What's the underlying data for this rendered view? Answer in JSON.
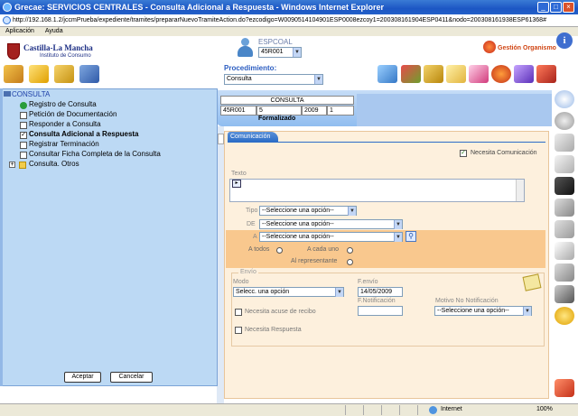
{
  "window": {
    "title": "Grecae: SERVICIOS CENTRALES - Consulta Adicional a Respuesta - Windows Internet Explorer",
    "url": "http://192.168.1.2/jccmPrueba/expediente/tramites/prepararNuevoTramiteAction.do?ezcodigo=W0090514104901ESP0008ezcoy1=200308161904ESP0411&nodo=200308161938ESP61368#"
  },
  "menu": {
    "items": [
      "Aplicación",
      "Ayuda"
    ]
  },
  "header": {
    "logo_title": "Castilla-La Mancha",
    "logo_subtitle": "Instituto de Consumo",
    "user_role": "ESPCOAL",
    "sede_value": "45R001",
    "gestion_label": "Gestión Organismo",
    "info_glyph": "i",
    "procedimiento_label": "Procedimiento:",
    "procedimiento_value": "Consulta"
  },
  "expediente": {
    "type": "CONSULTA",
    "cells": [
      "45R001",
      "5",
      "2009",
      "1"
    ],
    "status": "Formalizado"
  },
  "tree": {
    "root": "CONSULTA",
    "items": [
      "Registro de Consulta",
      "Petición de Documentación",
      "Responder a Consulta",
      "Consulta Adicional a Respuesta",
      "Registrar Terminación",
      "Consultar Ficha Completa de la Consulta",
      "Consulta. Otros"
    ],
    "accept_label": "Aceptar",
    "cancel_label": "Cancelar"
  },
  "form": {
    "tab_label": "Comunicación",
    "necesita_comunicacion": "Necesita Comunicación",
    "texto_label": "Texto",
    "texto_button": "▸",
    "tipo_label": "Tipo",
    "de_label": "DE",
    "a_label": "A",
    "select_placeholder": "--Seleccione una opción--",
    "radio_todos": "A todos",
    "radio_cada_uno": "A cada uno",
    "radio_representante": "Al representante",
    "envio_label": "Envío",
    "modo_label": "Modo",
    "modo_value": "Selecc. una opción",
    "fenvio_label": "F.envío",
    "fenvio_value": "14/05/2009",
    "fnotificacion_label": "F.Notificación",
    "motivo_label": "Motivo No Notificación",
    "acuse_label": "Necesita acuse de recibo",
    "respuesta_label": "Necesita Respuesta"
  },
  "status": {
    "zone": "Internet",
    "zoom": "100%"
  }
}
